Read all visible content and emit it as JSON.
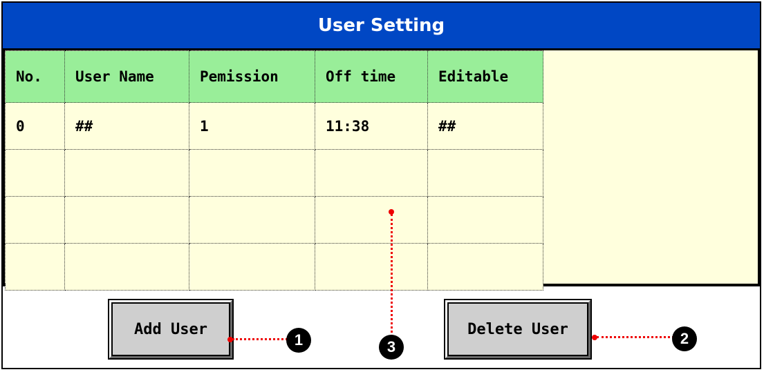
{
  "title": "User Setting",
  "table": {
    "headers": [
      "No.",
      "User Name",
      "Pemission",
      "Off time",
      "Editable"
    ],
    "rows": [
      [
        "0",
        "##",
        "1",
        "11:38",
        "##"
      ],
      [
        "",
        "",
        "",
        "",
        ""
      ],
      [
        "",
        "",
        "",
        "",
        ""
      ],
      [
        "",
        "",
        "",
        "",
        ""
      ]
    ]
  },
  "buttons": {
    "add_user": "Add User",
    "delete_user": "Delete User"
  },
  "callouts": [
    "1",
    "2",
    "3"
  ],
  "colors": {
    "title_bar": "#0047c4",
    "header_bg": "#99ee99",
    "panel_bg": "#ffffdd",
    "annotation": "#e00000"
  }
}
